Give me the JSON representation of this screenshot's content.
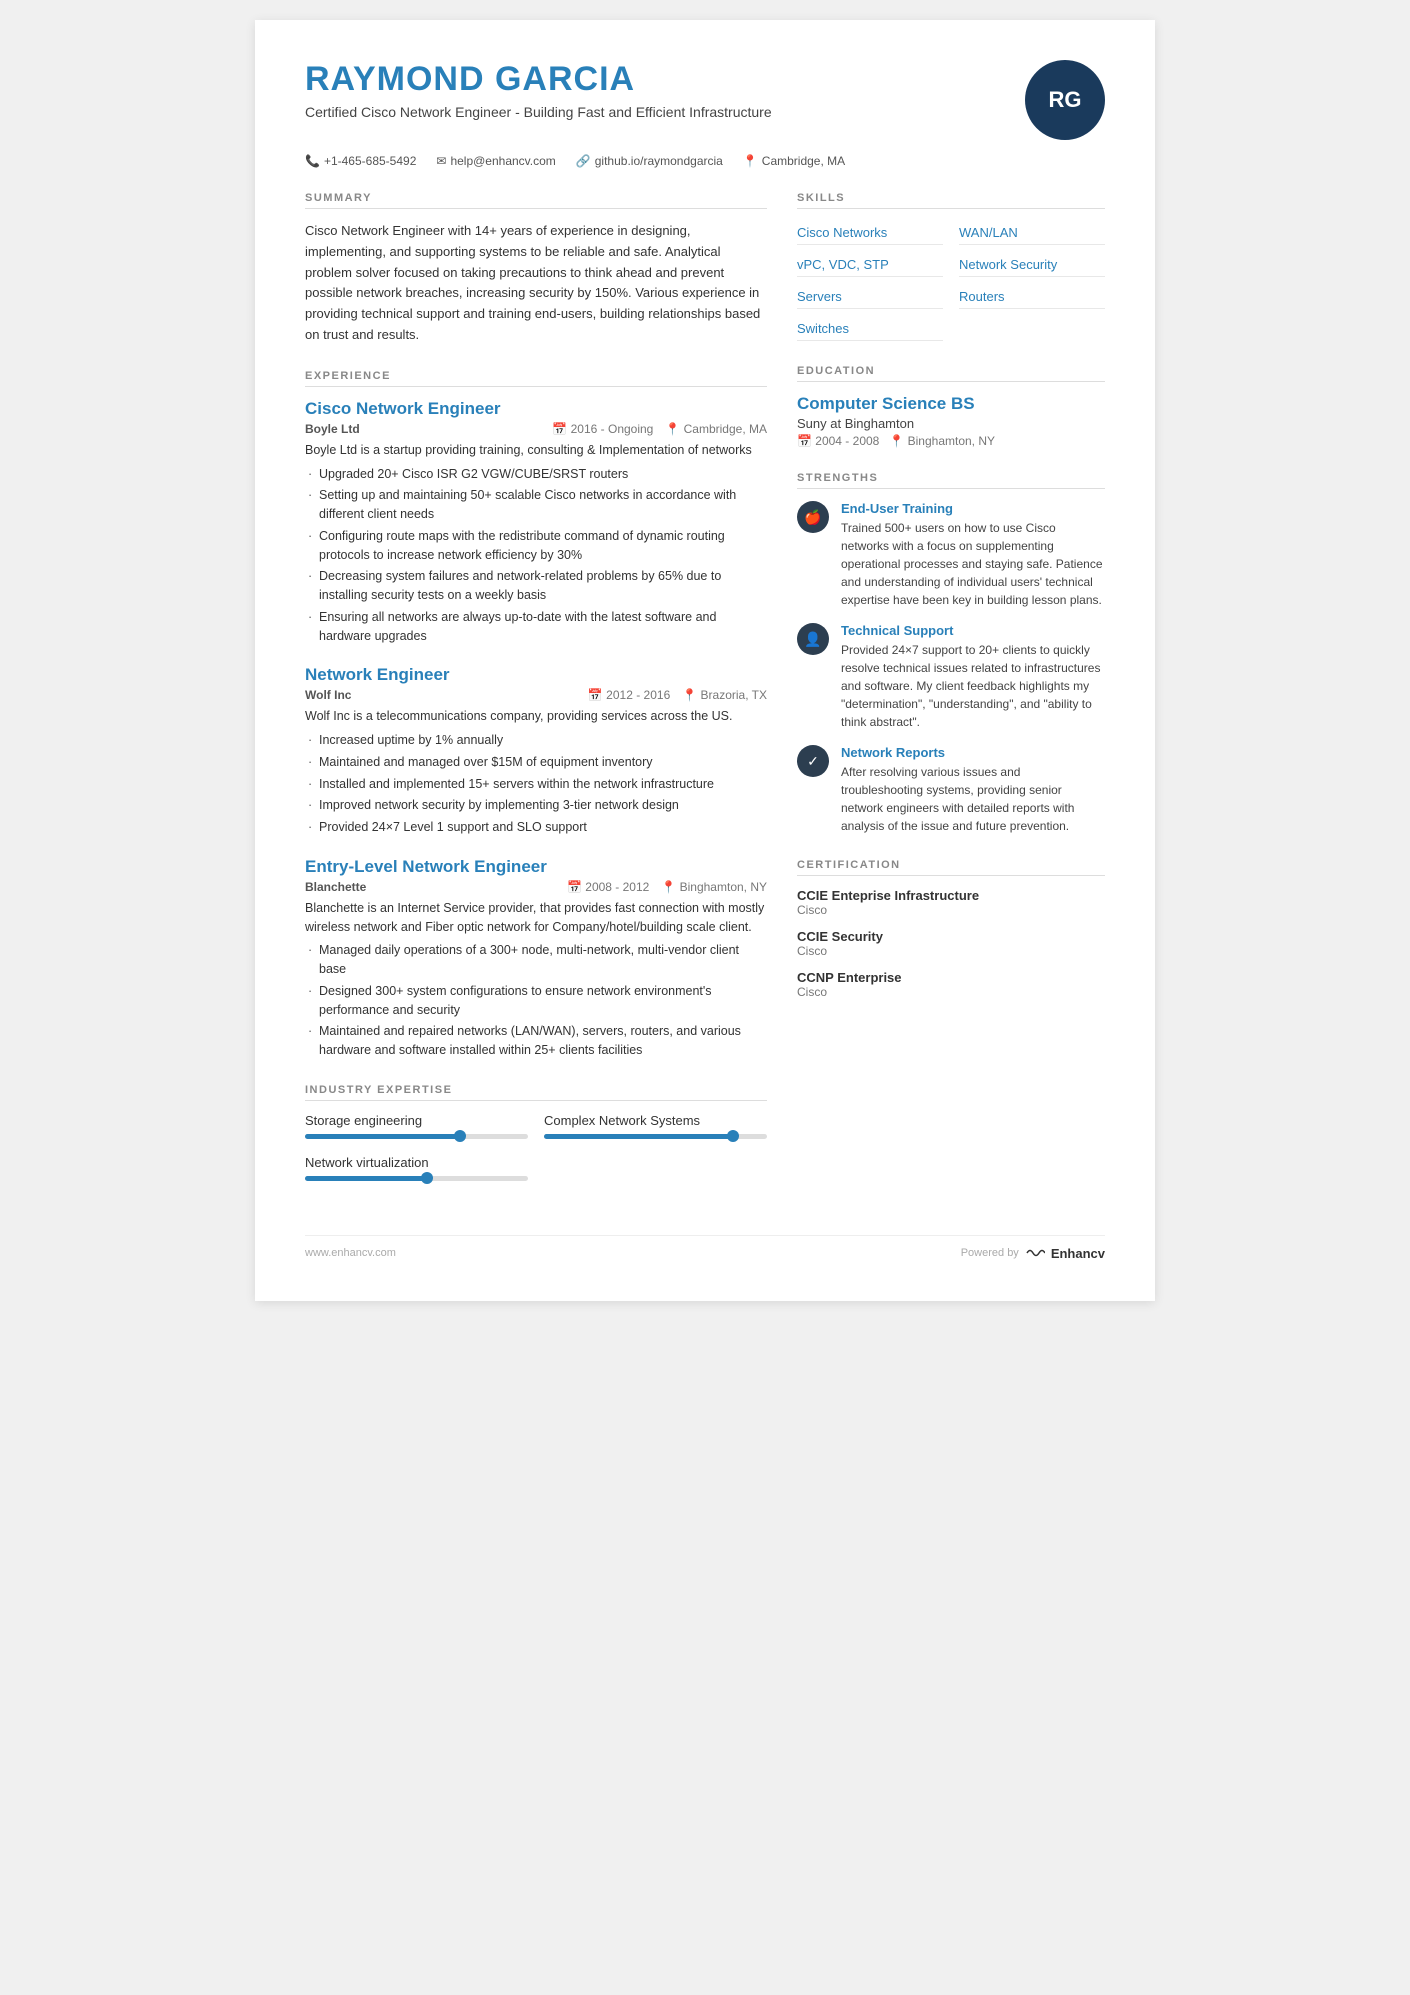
{
  "header": {
    "name": "RAYMOND GARCIA",
    "tagline": "Certified Cisco Network Engineer - Building Fast and Efficient Infrastructure",
    "avatar_initials": "RG",
    "contact": {
      "phone": "+1-465-685-5492",
      "email": "help@enhancv.com",
      "github": "github.io/raymondgarcia",
      "location": "Cambridge, MA"
    }
  },
  "summary": {
    "section_title": "SUMMARY",
    "text": "Cisco Network Engineer with 14+ years of experience in designing, implementing, and supporting systems to be reliable and safe. Analytical problem solver focused on taking precautions to think ahead and prevent possible network breaches, increasing security by 150%. Various experience in providing technical support and training end-users, building relationships based on trust and results."
  },
  "experience": {
    "section_title": "EXPERIENCE",
    "jobs": [
      {
        "title": "Cisco Network Engineer",
        "company": "Boyle Ltd",
        "period": "2016 - Ongoing",
        "location": "Cambridge, MA",
        "description": "Boyle Ltd is a startup providing training, consulting & Implementation of networks",
        "bullets": [
          "Upgraded 20+ Cisco ISR G2 VGW/CUBE/SRST routers",
          "Setting up and maintaining 50+ scalable Cisco networks in accordance with different client needs",
          "Configuring route maps with the redistribute command of dynamic routing protocols to increase network efficiency by 30%",
          "Decreasing system failures and network-related problems by 65% due to installing security tests on a weekly basis",
          "Ensuring all networks are always up-to-date with the latest software and hardware upgrades"
        ]
      },
      {
        "title": "Network Engineer",
        "company": "Wolf Inc",
        "period": "2012 - 2016",
        "location": "Brazoria, TX",
        "description": "Wolf Inc is a telecommunications company, providing services across the US.",
        "bullets": [
          "Increased uptime by 1% annually",
          "Maintained and managed over $15M of equipment inventory",
          "Installed and implemented 15+ servers within the network infrastructure",
          "Improved network security by implementing 3-tier network design",
          "Provided 24×7 Level 1 support and SLO support"
        ]
      },
      {
        "title": "Entry-Level Network Engineer",
        "company": "Blanchette",
        "period": "2008 - 2012",
        "location": "Binghamton, NY",
        "description": "Blanchette is an Internet Service provider, that provides fast connection with mostly wireless network and Fiber optic network for Company/hotel/building scale client.",
        "bullets": [
          "Managed daily operations of a 300+ node, multi-network, multi-vendor client base",
          "Designed 300+ system configurations to ensure network environment's performance and security",
          "Maintained and repaired networks (LAN/WAN), servers, routers, and various hardware and software installed within 25+ clients facilities"
        ]
      }
    ]
  },
  "industry_expertise": {
    "section_title": "INDUSTRY EXPERTISE",
    "items": [
      {
        "label": "Storage engineering",
        "percent": 70
      },
      {
        "label": "Complex Network Systems",
        "percent": 85
      },
      {
        "label": "Network virtualization",
        "percent": 55
      }
    ]
  },
  "skills": {
    "section_title": "SKILLS",
    "items": [
      "Cisco Networks",
      "WAN/LAN",
      "vPC, VDC, STP",
      "Network Security",
      "Servers",
      "Routers",
      "Switches"
    ]
  },
  "education": {
    "section_title": "EDUCATION",
    "degree": "Computer Science BS",
    "school": "Suny at Binghamton",
    "period": "2004 - 2008",
    "location": "Binghamton, NY"
  },
  "strengths": {
    "section_title": "STRENGTHS",
    "items": [
      {
        "icon": "🍎",
        "title": "End-User Training",
        "text": "Trained 500+ users on how to use Cisco networks with a focus on supplementing operational processes and staying safe. Patience and understanding of individual users' technical expertise have been key in building lesson plans."
      },
      {
        "icon": "👤",
        "title": "Technical Support",
        "text": "Provided 24×7 support to 20+ clients to quickly resolve technical issues related to infrastructures and software. My client feedback highlights my \"determination\", \"understanding\", and \"ability to think abstract\"."
      },
      {
        "icon": "✓",
        "title": "Network Reports",
        "text": "After resolving various issues and troubleshooting systems, providing senior network engineers with detailed reports with analysis of the issue and future prevention."
      }
    ]
  },
  "certification": {
    "section_title": "CERTIFICATION",
    "items": [
      {
        "name": "CCIE Enteprise Infrastructure",
        "org": "Cisco"
      },
      {
        "name": "CCIE Security",
        "org": "Cisco"
      },
      {
        "name": "CCNP Enterprise",
        "org": "Cisco"
      }
    ]
  },
  "footer": {
    "website": "www.enhancv.com",
    "powered_by": "Powered by",
    "brand": "Enhancv"
  }
}
